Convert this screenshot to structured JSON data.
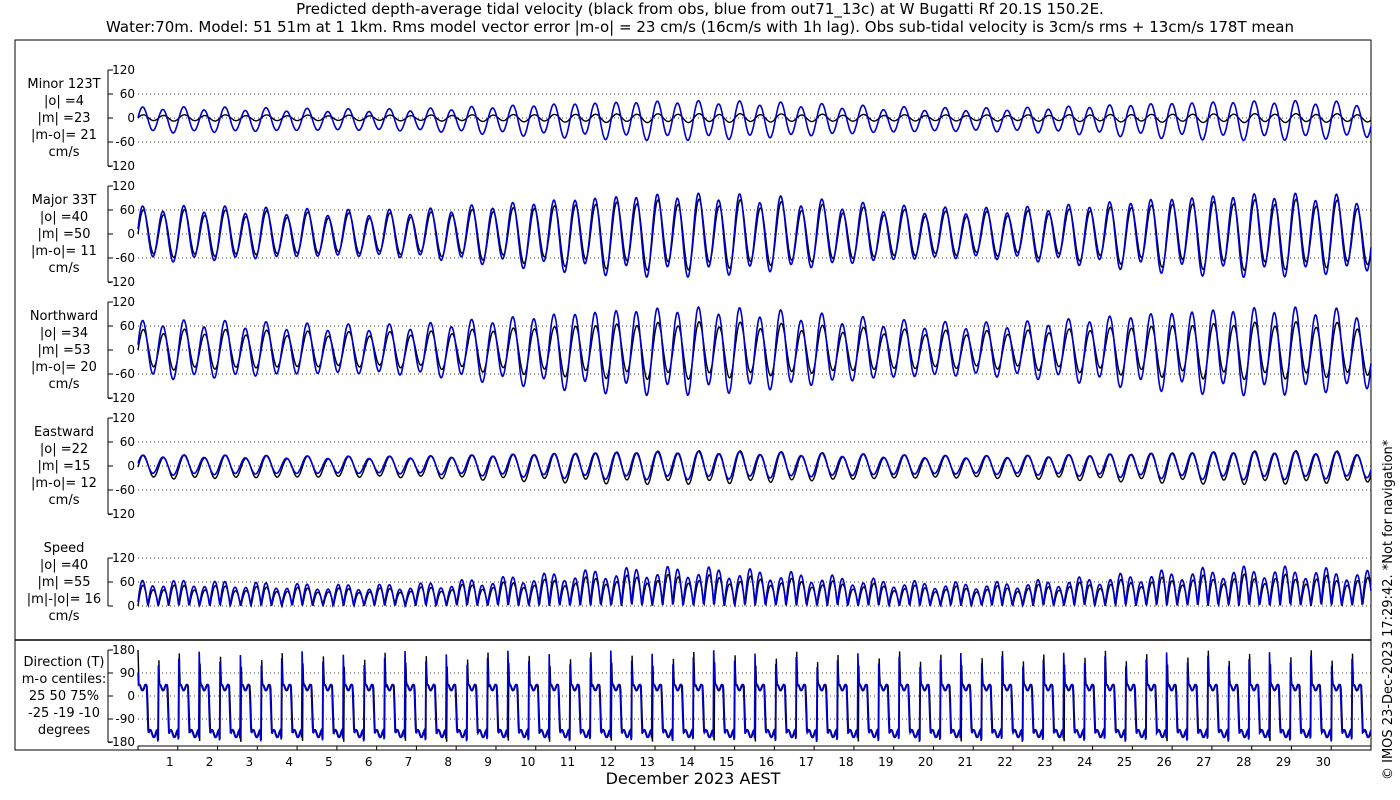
{
  "title_line1": "Predicted depth-average tidal velocity (black from obs, blue from out71_13c) at W Bugatti Rf 20.1S 150.2E.",
  "title_line2": "Water:70m. Model: 51 51m at 1 1km. Rms model vector error |m-o| = 23 cm/s (16cm/s with 1h lag). Obs sub-tidal velocity is 3cm/s rms + 13cm/s 178T mean",
  "xlabel": "December 2023 AEST",
  "credit": "© IMOS 23-Dec-2023 17:29:42. *Not for navigation*",
  "colors": {
    "obs": "#000000",
    "model": "#0000cc",
    "grid": "#000000"
  },
  "chart_data": [
    {
      "type": "line",
      "name": "minor",
      "label_lines": [
        "Minor 123T",
        "|o| =4",
        "|m| =23",
        "|m-o|= 21",
        "cm/s"
      ],
      "ylim": [
        -120,
        120
      ],
      "yticks": [
        120,
        60,
        0,
        -60,
        -120
      ],
      "grid_y": [
        60,
        0,
        -60
      ],
      "x_range_days": [
        0,
        31
      ],
      "series": [
        {
          "name": "obs",
          "amplitude_range": [
            4,
            10
          ],
          "mean": 0
        },
        {
          "name": "model",
          "amplitude_range": [
            12,
            45
          ],
          "mean": -5
        }
      ]
    },
    {
      "type": "line",
      "name": "major",
      "label_lines": [
        "Major 33T",
        "|o| =40",
        "|m| =50",
        "|m-o|= 11",
        "cm/s"
      ],
      "ylim": [
        -120,
        120
      ],
      "yticks": [
        120,
        60,
        0,
        -60,
        -120
      ],
      "grid_y": [
        60,
        0,
        -60
      ],
      "x_range_days": [
        0,
        31
      ],
      "series": [
        {
          "name": "obs",
          "amplitude_range": [
            25,
            80
          ],
          "mean": 0
        },
        {
          "name": "model",
          "amplitude_range": [
            28,
            95
          ],
          "mean": 0
        }
      ]
    },
    {
      "type": "line",
      "name": "northward",
      "label_lines": [
        "Northward",
        "|o| =34",
        "|m| =53",
        "|m-o|= 20",
        "cm/s"
      ],
      "ylim": [
        -120,
        120
      ],
      "yticks": [
        120,
        60,
        0,
        -60,
        -120
      ],
      "grid_y": [
        60,
        0,
        -60
      ],
      "x_range_days": [
        0,
        31
      ],
      "series": [
        {
          "name": "obs",
          "amplitude_range": [
            25,
            65
          ],
          "mean": 0
        },
        {
          "name": "model",
          "amplitude_range": [
            30,
            100
          ],
          "mean": 0
        }
      ]
    },
    {
      "type": "line",
      "name": "eastward",
      "label_lines": [
        "Eastward",
        "|o| =22",
        "|m| =15",
        "|m-o|= 12",
        "cm/s"
      ],
      "ylim": [
        -120,
        120
      ],
      "yticks": [
        120,
        60,
        0,
        -60,
        -120
      ],
      "grid_y": [
        60,
        0,
        -60
      ],
      "x_range_days": [
        0,
        31
      ],
      "series": [
        {
          "name": "obs",
          "amplitude_range": [
            15,
            38
          ],
          "mean": -3
        },
        {
          "name": "model",
          "amplitude_range": [
            12,
            32
          ],
          "mean": 2
        }
      ]
    },
    {
      "type": "line",
      "name": "speed",
      "label_lines": [
        "Speed",
        "|o| =40",
        "|m| =55",
        "|m|-|o|= 16",
        "cm/s"
      ],
      "ylim": [
        0,
        120
      ],
      "yticks": [
        120,
        60,
        0
      ],
      "grid_y": [
        120,
        60,
        0
      ],
      "x_range_days": [
        0,
        31
      ],
      "series": [
        {
          "name": "obs",
          "amplitude_range": [
            25,
            80
          ],
          "mean": 0
        },
        {
          "name": "model",
          "amplitude_range": [
            28,
            100
          ],
          "mean": 0
        }
      ]
    },
    {
      "type": "line",
      "name": "direction",
      "label_lines": [
        "Direction (T)",
        "m-o centiles:",
        "25  50  75%",
        "-25 -19 -10",
        "degrees"
      ],
      "ylim": [
        -180,
        180
      ],
      "yticks": [
        180,
        90,
        0,
        -90,
        -180
      ],
      "grid_y": [
        90,
        0,
        -90
      ],
      "x_range_days": [
        0,
        31
      ],
      "series": [
        {
          "name": "obs",
          "plateau_values": [
            33,
            -147
          ]
        },
        {
          "name": "model",
          "plateau_values": [
            33,
            -147
          ]
        }
      ]
    }
  ],
  "x_ticks": [
    "1",
    "2",
    "3",
    "4",
    "5",
    "6",
    "7",
    "8",
    "9",
    "10",
    "11",
    "12",
    "13",
    "14",
    "15",
    "16",
    "17",
    "18",
    "19",
    "20",
    "21",
    "22",
    "23",
    "24",
    "25",
    "26",
    "27",
    "28",
    "29",
    "30"
  ]
}
